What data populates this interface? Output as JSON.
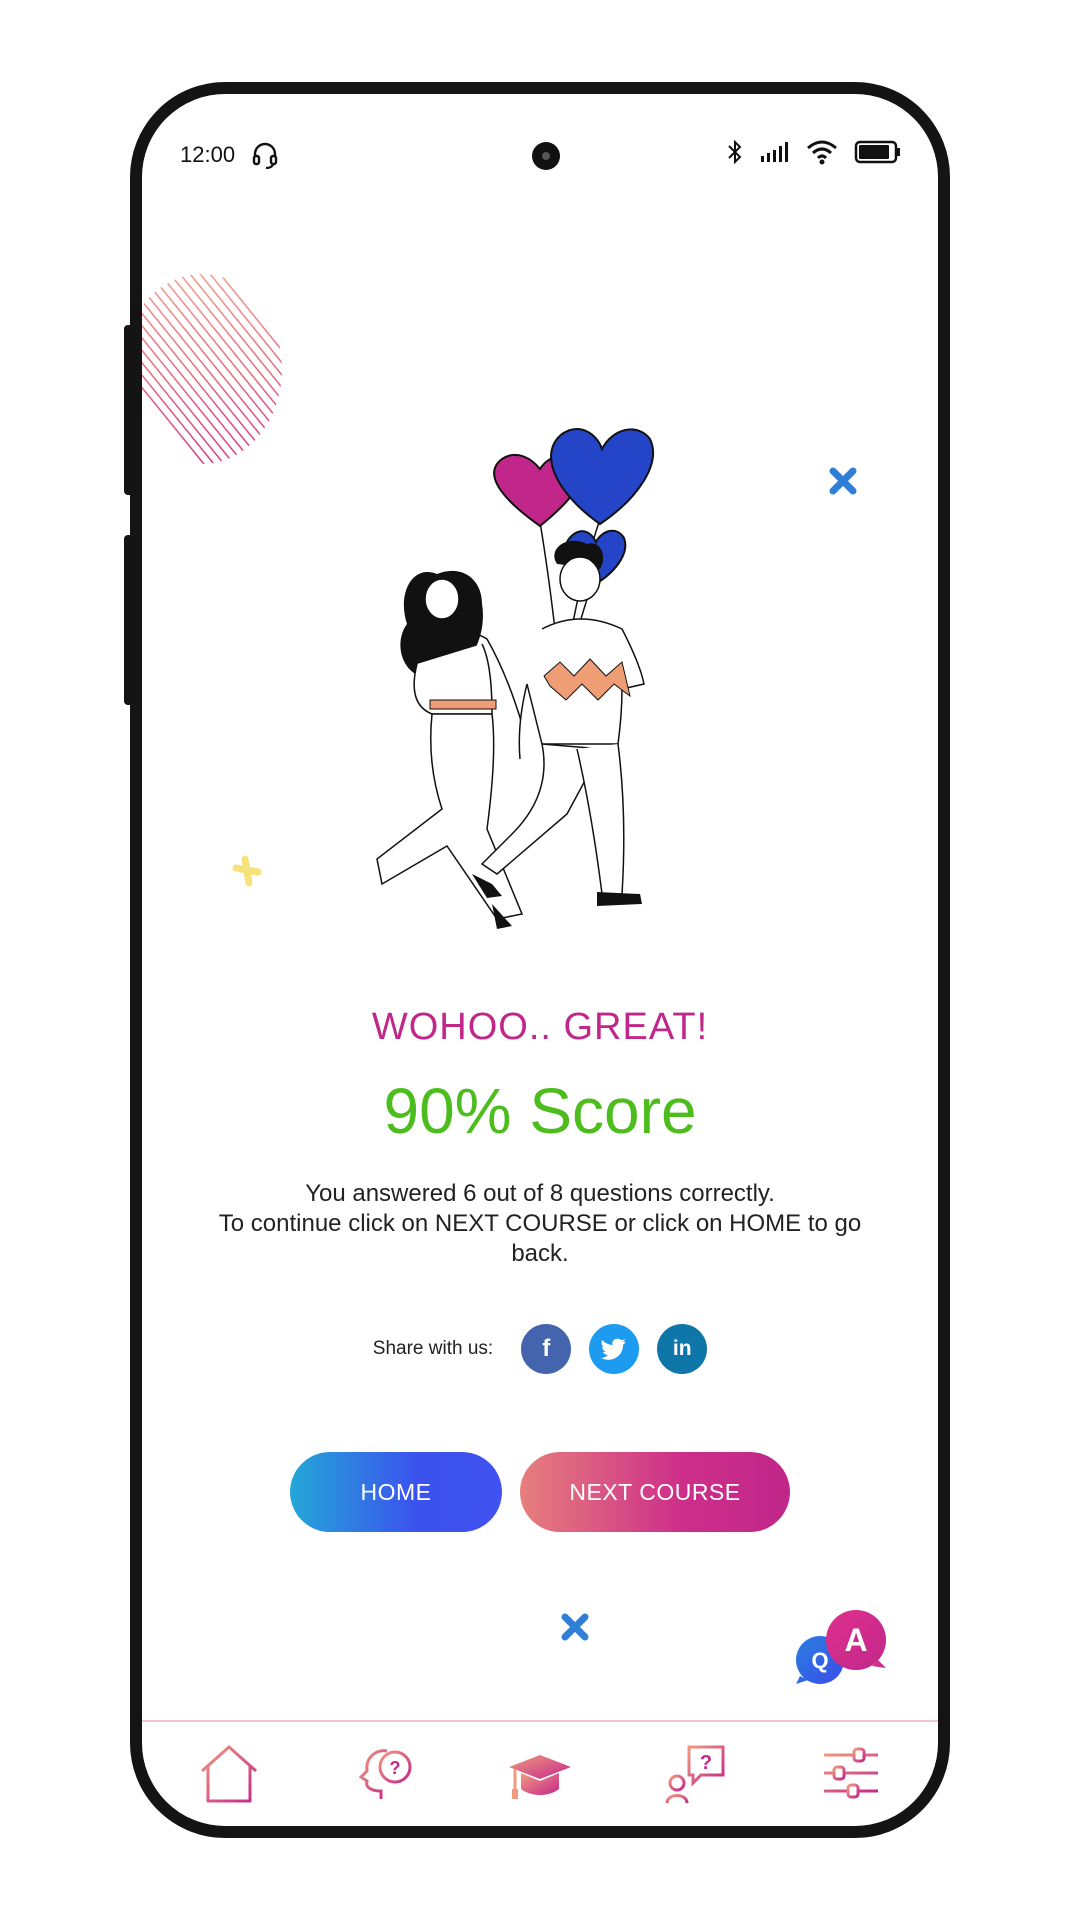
{
  "status_bar": {
    "time": "12:00"
  },
  "result": {
    "headline": "WOHOO.. GREAT!",
    "score": "90% Score",
    "description_line1": "You answered 6 out of 8 questions correctly.",
    "description_line2": "To continue click on NEXT COURSE or click on HOME to go back."
  },
  "share": {
    "label": "Share with us:",
    "networks": [
      {
        "icon": "facebook-icon",
        "glyph": "f",
        "color": "#4465ad"
      },
      {
        "icon": "twitter-icon",
        "glyph": "",
        "color": "#1d9bf0"
      },
      {
        "icon": "linkedin-icon",
        "glyph": "in",
        "color": "#0e76a8"
      }
    ]
  },
  "buttons": {
    "home_label": "HOME",
    "next_label": "NEXT COURSE"
  },
  "bottom_nav": {
    "items": [
      {
        "icon": "home-icon"
      },
      {
        "icon": "quiz-head-icon"
      },
      {
        "icon": "graduation-cap-icon"
      },
      {
        "icon": "ask-question-icon"
      },
      {
        "icon": "settings-sliders-icon"
      }
    ]
  },
  "colors": {
    "headline": "#c1278a",
    "score": "#4dbd1e",
    "home_gradient": [
      "#23a7d8",
      "#4152f0"
    ],
    "next_gradient": [
      "#e67f7c",
      "#c0278a"
    ]
  }
}
